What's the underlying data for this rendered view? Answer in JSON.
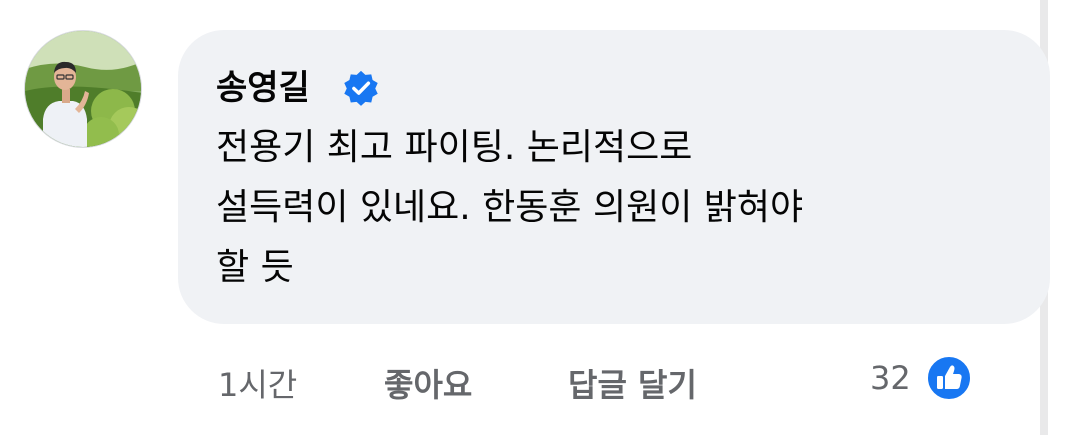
{
  "comment": {
    "author": "송영길",
    "verified_icon": "verified-badge-icon",
    "text_lines": [
      "전용기 최고 파이팅. 논리적으로",
      "설득력이 있네요. 한동훈 의원이 밝혀야",
      "할 듯"
    ],
    "timestamp": "1시간",
    "like_label": "좋아요",
    "reply_label": "답글 달기",
    "reaction_count": "32",
    "reaction_icon": "thumbs-up-icon"
  },
  "colors": {
    "bubble_bg": "#f0f2f5",
    "primary_text": "#050505",
    "secondary_text": "#65676b",
    "accent_blue": "#1877f2"
  }
}
